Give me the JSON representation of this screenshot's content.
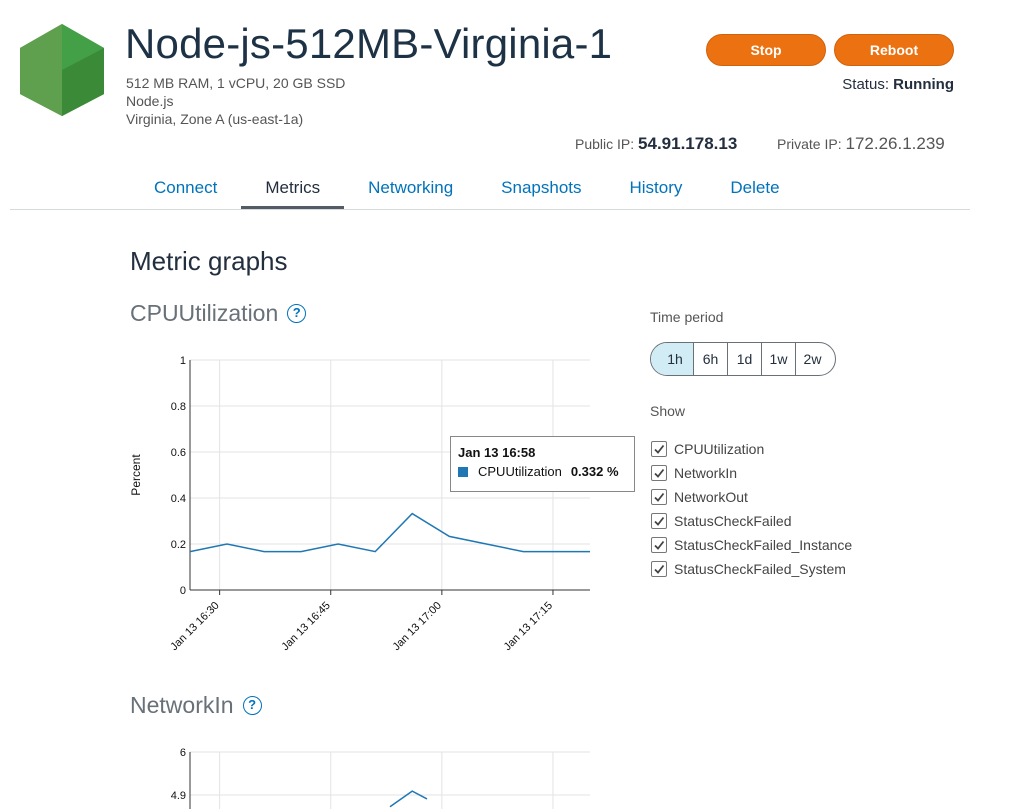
{
  "instance": {
    "name": "Node-js-512MB-Virginia-1",
    "specs": "512 MB RAM, 1 vCPU, 20 GB SSD",
    "blueprint": "Node.js",
    "location": "Virginia, Zone A (us-east-1a)"
  },
  "actions": {
    "stop_label": "Stop",
    "reboot_label": "Reboot"
  },
  "status": {
    "label": "Status:",
    "value": "Running"
  },
  "network": {
    "public_label": "Public IP:",
    "public_ip": "54.91.178.13",
    "private_label": "Private IP:",
    "private_ip": "172.26.1.239"
  },
  "tabs": [
    {
      "label": "Connect",
      "active": false
    },
    {
      "label": "Metrics",
      "active": true
    },
    {
      "label": "Networking",
      "active": false
    },
    {
      "label": "Snapshots",
      "active": false
    },
    {
      "label": "History",
      "active": false
    },
    {
      "label": "Delete",
      "active": false
    }
  ],
  "section_title": "Metric graphs",
  "graphs": [
    {
      "title": "CPUUtilization",
      "help": "?"
    },
    {
      "title": "NetworkIn",
      "help": "?"
    }
  ],
  "tooltip": {
    "date": "Jan 13 16:58",
    "series": "CPUUtilization",
    "value": "0.332 %"
  },
  "time_period": {
    "label": "Time period",
    "options": [
      "1h",
      "6h",
      "1d",
      "1w",
      "2w"
    ],
    "selected": "1h"
  },
  "show": {
    "label": "Show",
    "items": [
      {
        "label": "CPUUtilization",
        "checked": true
      },
      {
        "label": "NetworkIn",
        "checked": true
      },
      {
        "label": "NetworkOut",
        "checked": true
      },
      {
        "label": "StatusCheckFailed",
        "checked": true
      },
      {
        "label": "StatusCheckFailed_Instance",
        "checked": true
      },
      {
        "label": "StatusCheckFailed_System",
        "checked": true
      }
    ]
  },
  "colors": {
    "accent": "#ec7211",
    "link": "#0073bb",
    "series": "#1f77b4",
    "selected_period": "#d1ecf5"
  },
  "chart_data": [
    {
      "type": "line",
      "ylabel": "Percent",
      "ylim": [
        0,
        1
      ],
      "yticks": [
        "0",
        "0.2",
        "0.4",
        "0.6",
        "0.8",
        "1"
      ],
      "xticks": [
        "Jan 13 16:30",
        "Jan 13 16:45",
        "Jan 13 17:00",
        "Jan 13 17:15"
      ],
      "xlim": [
        "16:26",
        "17:20"
      ],
      "grid": true,
      "series": [
        {
          "name": "CPUUtilization",
          "x": [
            "16:26",
            "16:31",
            "16:36",
            "16:41",
            "16:46",
            "16:51",
            "16:56",
            "17:01",
            "17:06",
            "17:11",
            "17:16",
            "17:20"
          ],
          "y": [
            0.167,
            0.2,
            0.167,
            0.167,
            0.2,
            0.167,
            0.332,
            0.233,
            0.2,
            0.167,
            0.167,
            0.167
          ]
        }
      ]
    },
    {
      "type": "line",
      "yticks": [
        "4.9",
        "6"
      ],
      "ylim_visible": [
        4.9,
        6
      ],
      "xlim": [
        "16:26",
        "17:20"
      ],
      "grid": true,
      "series": [
        {
          "x": [
            "16:53",
            "16:56",
            "16:58"
          ],
          "y": [
            4.6,
            5.0,
            4.8
          ]
        }
      ]
    }
  ]
}
